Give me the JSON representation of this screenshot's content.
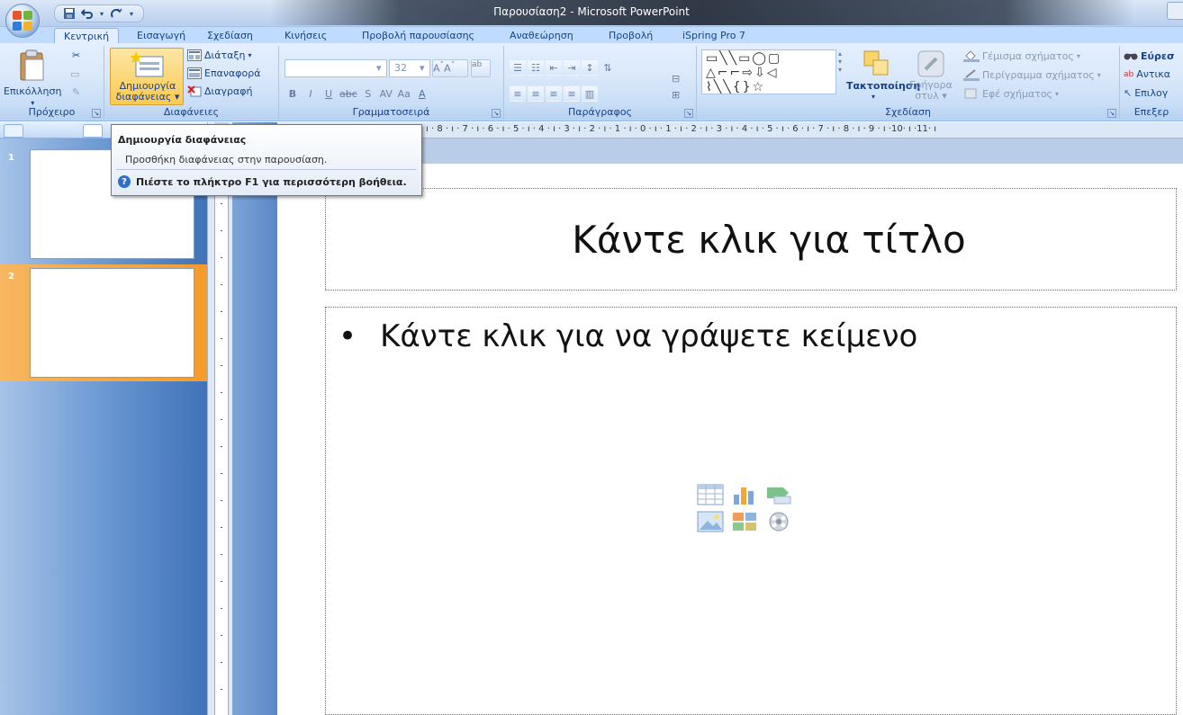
{
  "window": {
    "title": "Παρουσίαση2 - Microsoft PowerPoint"
  },
  "tabs": [
    {
      "label": "Κεντρική",
      "active": true
    },
    {
      "label": "Εισαγωγή"
    },
    {
      "label": "Σχεδίαση"
    },
    {
      "label": "Κινήσεις"
    },
    {
      "label": "Προβολή παρουσίασης"
    },
    {
      "label": "Αναθεώρηση"
    },
    {
      "label": "Προβολή"
    },
    {
      "label": "iSpring Pro 7"
    }
  ],
  "ribbon": {
    "clipboard": {
      "paste": "Επικόλληση",
      "label": "Πρόχειρο"
    },
    "slides": {
      "new_slide_1": "Δημιουργία",
      "new_slide_2": "διαφάνειας",
      "layout": "Διάταξη",
      "reset": "Επαναφορά",
      "delete": "Διαγραφή",
      "label": "Διαφάνειες"
    },
    "font": {
      "size": "32",
      "label": "Γραμματοσειρά"
    },
    "paragraph": {
      "label": "Παράγραφος"
    },
    "drawing": {
      "arrange": "Τακτοποίηση",
      "quick_styles_1": "Γρήγορα",
      "quick_styles_2": "στυλ",
      "shape_fill": "Γέμισμα σχήματος",
      "shape_outline": "Περίγραμμα σχήματος",
      "shape_effects": "Εφέ σχήματος",
      "label": "Σχεδίαση"
    },
    "editing": {
      "find": "Εύρεσ",
      "replace": "Αντικα",
      "select": "Επιλογ",
      "label": "Επεξερ"
    }
  },
  "tooltip": {
    "title": "Δημιουργία διαφάνειας",
    "description": "Προσθήκη διαφάνειας στην παρουσίαση.",
    "help": "Πιέστε το πλήκτρο F1 για περισσότερη βοήθεια."
  },
  "slides_panel": {
    "slides": [
      {
        "number": "1"
      },
      {
        "number": "2",
        "selected": true
      }
    ]
  },
  "ruler": {
    "horizontal": "ı · 8 · ı · 7 · ı · 6 · ı · 5 · ı · 4 · ı · 3 · ı · 2 · ı · 1 · ı · 0 · ı · 1 · ı · 2 · ı · 3 · ı · 4 · ı · 5 · ı · 6 · ı · 7 · ı · 8 · ı · 9 · ı ·10· ı ·11· ı"
  },
  "slide": {
    "title_placeholder": "Κάντε κλικ για τίτλο",
    "bullet": "•",
    "body_placeholder": "Κάντε κλικ για να γράψετε κείμενο",
    "insert_icons": [
      "table-icon",
      "chart-icon",
      "smartart-icon",
      "picture-icon",
      "clipart-icon",
      "media-icon"
    ]
  }
}
